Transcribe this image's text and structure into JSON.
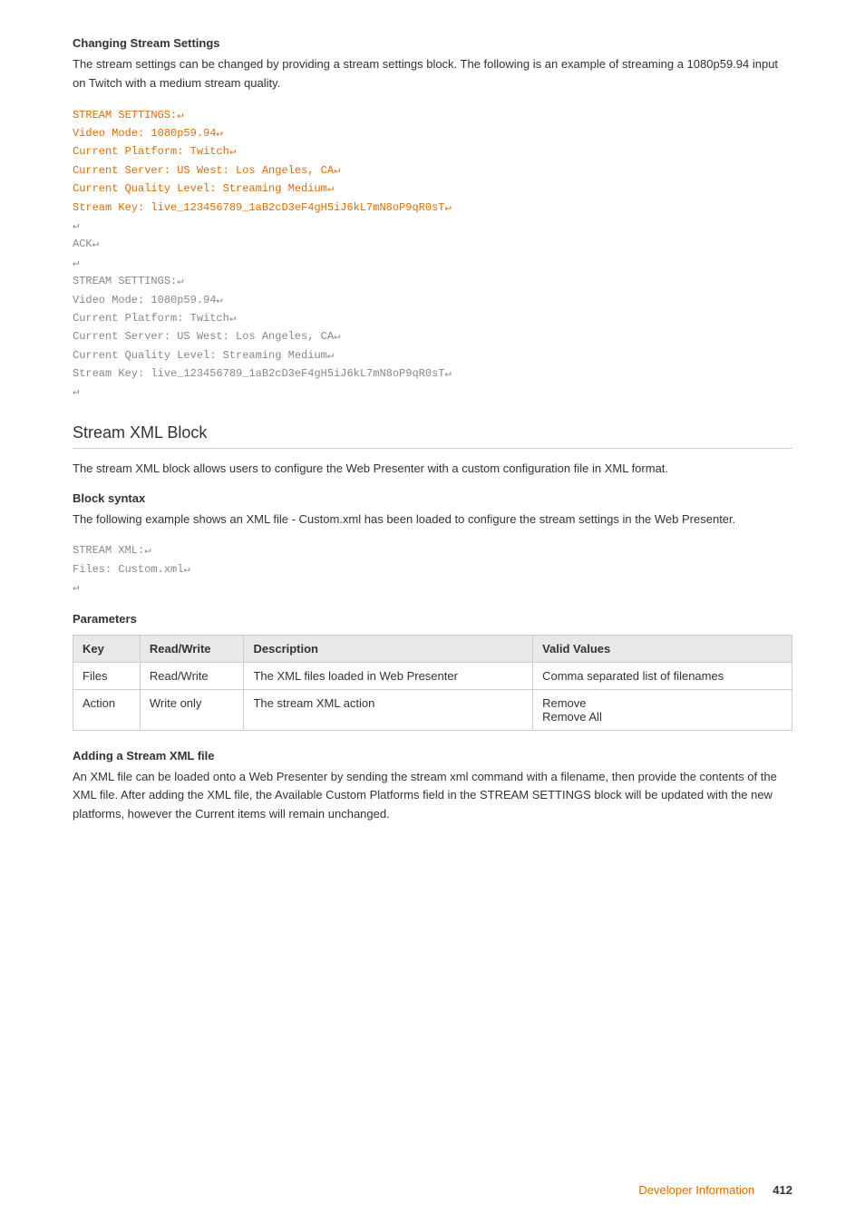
{
  "sections": {
    "changing_stream_settings": {
      "heading": "Changing Stream Settings",
      "body": "The stream settings can be changed by providing a stream settings block. The following is an example of streaming a 1080p59.94 input on Twitch with a medium stream quality.",
      "code_highlighted": [
        "STREAM SETTINGS:↵",
        "Video Mode: 1080p59.94↵",
        "Current Platform: Twitch↵",
        "Current Server: US West: Los Angeles, CA↵",
        "Current Quality Level: Streaming Medium↵",
        "Stream Key: live_123456789_1aB2cD3eF4gH5iJ6kL7mN8oP9qR0sT↵"
      ],
      "code_plain": [
        "↵",
        "ACK↵",
        "↵",
        "STREAM SETTINGS:↵",
        "Video Mode: 1080p59.94↵",
        "Current Platform: Twitch↵",
        "Current Server: US West: Los Angeles, CA↵",
        "Current Quality Level: Streaming Medium↵",
        "Stream Key: live_123456789_1aB2cD3eF4gH5iJ6kL7mN8oP9qR0sT↵",
        "↵"
      ]
    },
    "stream_xml_block": {
      "heading": "Stream XML Block",
      "body": "The stream XML block allows users to configure the Web Presenter with a custom configuration file in XML format.",
      "block_syntax": {
        "heading": "Block syntax",
        "body": "The following example shows an XML file - Custom.xml has been loaded to configure the stream settings in the Web Presenter.",
        "code": [
          "STREAM XML:↵",
          "Files: Custom.xml↵",
          "↵"
        ]
      },
      "parameters": {
        "heading": "Parameters",
        "columns": [
          "Key",
          "Read/Write",
          "Description",
          "Valid Values"
        ],
        "rows": [
          {
            "key": "Files",
            "rw": "Read/Write",
            "description": "The XML files loaded in Web Presenter",
            "valid_values": "Comma separated list of filenames"
          },
          {
            "key": "Action",
            "rw": "Write only",
            "description": "The stream XML action",
            "valid_values": "Remove\nRemove All"
          }
        ]
      },
      "adding_xml": {
        "heading": "Adding a Stream XML file",
        "body": "An XML file can be loaded onto a Web Presenter by sending the stream xml command with a filename, then provide the contents of the XML file. After adding the XML file, the Available Custom Platforms field in the STREAM SETTINGS block will be updated with the new platforms, however the Current items will remain unchanged."
      }
    }
  },
  "footer": {
    "link_text": "Developer Information",
    "page_number": "412"
  }
}
